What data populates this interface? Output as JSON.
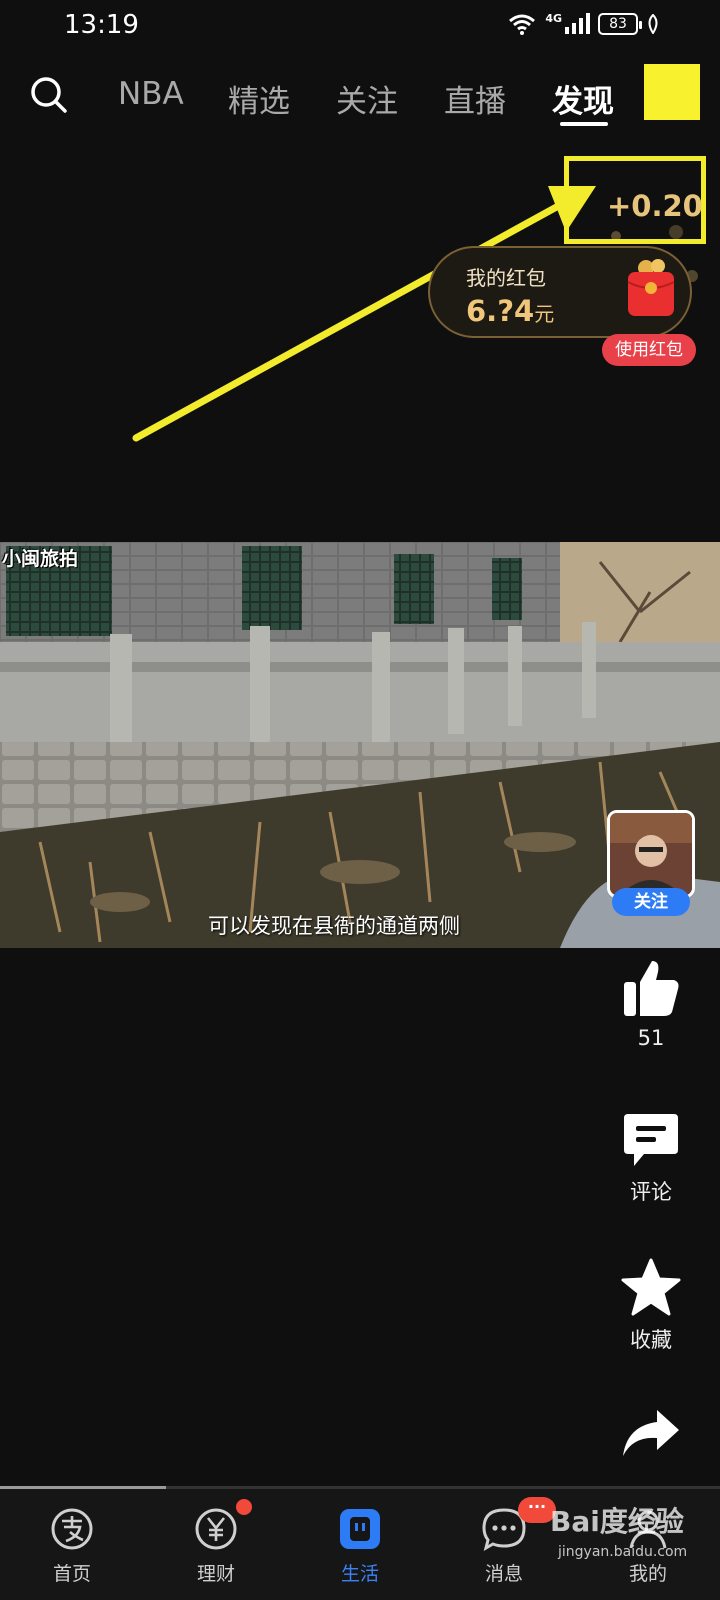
{
  "status_bar": {
    "time": "13:19",
    "network": "4G",
    "battery": "83",
    "icons": [
      "wifi-icon",
      "signal-icon",
      "battery-icon",
      "leaf-icon"
    ]
  },
  "top_nav": {
    "search_icon": "search-icon",
    "tabs": [
      {
        "label": "NBA",
        "active": false
      },
      {
        "label": "精选",
        "active": false
      },
      {
        "label": "关注",
        "active": false
      },
      {
        "label": "直播",
        "active": false
      },
      {
        "label": "发现",
        "active": true
      }
    ]
  },
  "reward": {
    "value": "+0.20"
  },
  "red_packet": {
    "title": "我的红包",
    "amount": "6.?4",
    "unit": "元",
    "use_button": "使用红包"
  },
  "video": {
    "watermark": "小闽旅拍",
    "subtitle": "可以发现在县衙的通道两侧"
  },
  "author": {
    "follow_label": "关注"
  },
  "actions": {
    "like_count": "51",
    "comment_label": "评论",
    "favorite_label": "收藏"
  },
  "progress": {
    "played_fraction": 0.23
  },
  "bottom_nav": {
    "items": [
      {
        "label": "首页",
        "icon": "alipay-icon",
        "active": false
      },
      {
        "label": "理财",
        "icon": "yuan-icon",
        "active": false,
        "badge": "dot"
      },
      {
        "label": "生活",
        "icon": "life-icon",
        "active": true
      },
      {
        "label": "消息",
        "icon": "message-icon",
        "active": false,
        "badge": "···"
      },
      {
        "label": "我的",
        "icon": "profile-icon",
        "active": false
      }
    ]
  },
  "site_watermark": {
    "brand": "Bai度经验",
    "url": "jingyan.baidu.com"
  },
  "colors": {
    "highlight_yellow": "#f2ec2d",
    "reward_gold": "#e7c47b",
    "packet_red": "#e8414a",
    "follow_blue": "#2d7cf6",
    "active_tab_blue": "#3a82f7"
  }
}
